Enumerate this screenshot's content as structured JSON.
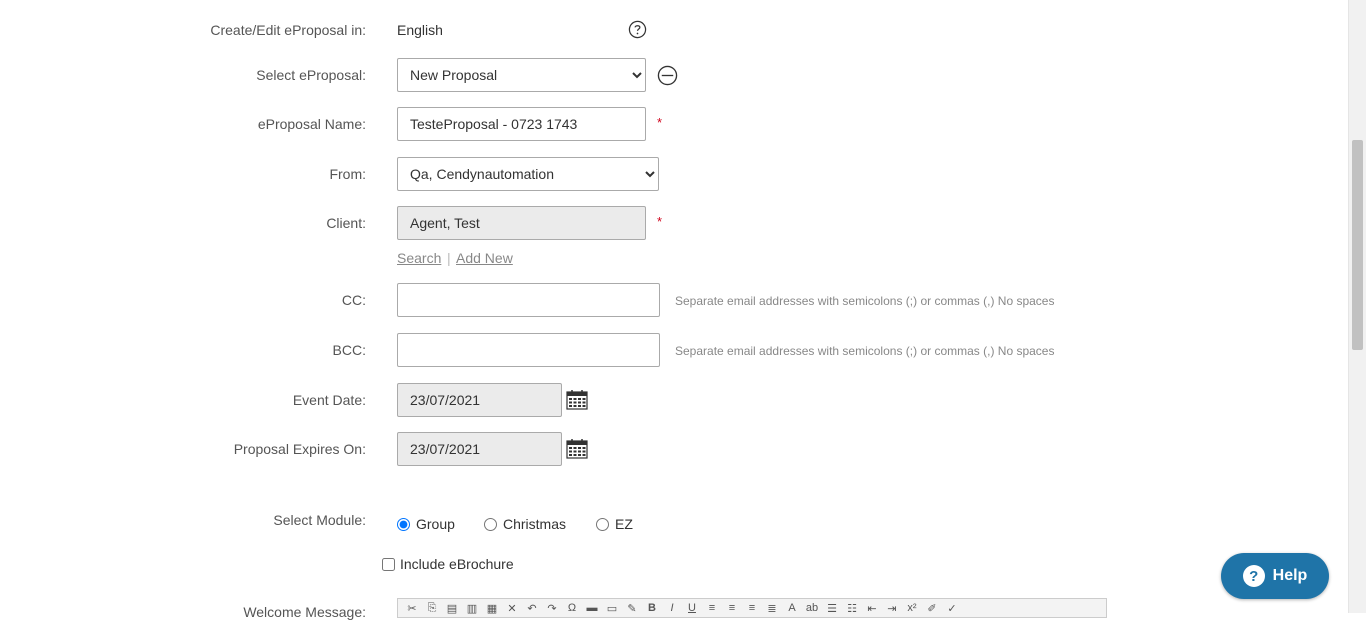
{
  "form": {
    "language_label": "Create/Edit eProposal in:",
    "language_value": "English",
    "select_label": "Select eProposal:",
    "select_value": "New Proposal",
    "name_label": "eProposal Name:",
    "name_value": "TesteProposal - 0723 1743",
    "from_label": "From:",
    "from_value": "Qa, Cendynautomation",
    "client_label": "Client:",
    "client_value": "Agent, Test",
    "search_link": "Search",
    "link_separator": "|",
    "add_new_link": "Add New",
    "cc_label": "CC:",
    "cc_value": "",
    "cc_hint": "Separate email addresses with semicolons (;) or commas (,) No spaces",
    "bcc_label": "BCC:",
    "bcc_value": "",
    "bcc_hint": "Separate email addresses with semicolons (;) or commas (,) No spaces",
    "event_date_label": "Event Date:",
    "event_date_value": "23/07/2021",
    "expires_label": "Proposal Expires On:",
    "expires_value": "23/07/2021",
    "module_label": "Select Module:",
    "modules": [
      {
        "label": "Group",
        "checked": true
      },
      {
        "label": "Christmas",
        "checked": false
      },
      {
        "label": "EZ",
        "checked": false
      }
    ],
    "include_brochure_label": "Include eBrochure",
    "welcome_label": "Welcome Message:",
    "required_marker": "*"
  },
  "help_button_label": "Help",
  "icons": {
    "info": "question-circle-icon",
    "remove": "minus-circle-icon",
    "calendar": "calendar-icon"
  },
  "colors": {
    "required": "#d0021b",
    "help_bg": "#1f74a8"
  }
}
